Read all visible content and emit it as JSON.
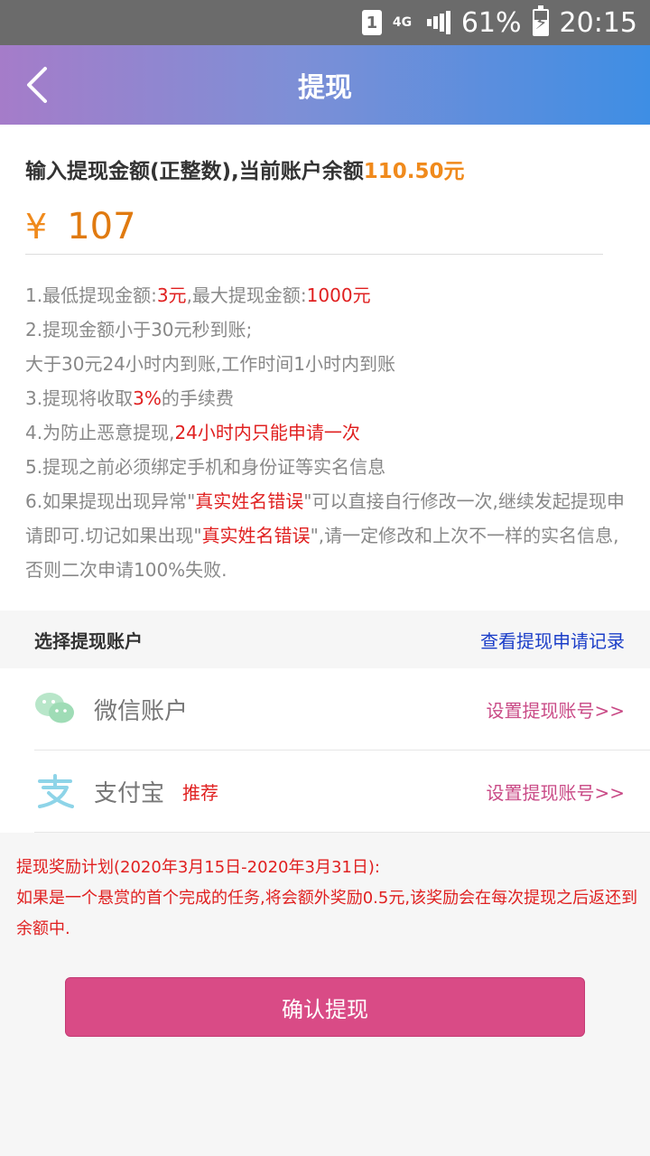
{
  "status_bar": {
    "sim": "1",
    "network": "4G",
    "battery": "61%",
    "time": "20:15"
  },
  "header": {
    "title": "提现",
    "background_gradient": [
      "#a57cc9",
      "#3e8ee4"
    ]
  },
  "amount": {
    "prompt_prefix": "输入提现金额(正整数),当前账户余额",
    "balance": "110.50元",
    "currency_symbol": "¥",
    "value": "107"
  },
  "rules": {
    "r1_a": "1.最低提现金额:",
    "r1_min": "3元",
    "r1_b": ",最大提现金额:",
    "r1_max": "1000元",
    "r2": "2.提现金额小于30元秒到账;",
    "r2b": "大于30元24小时内到账,工作时间1小时内到账",
    "r3_a": "3.提现将收取",
    "r3_fee": "3%",
    "r3_b": "的手续费",
    "r4_a": "4.为防止恶意提现,",
    "r4_limit": "24小时内只能申请一次",
    "r5": "5.提现之前必须绑定手机和身份证等实名信息",
    "r6_a": "6.如果提现出现异常\"",
    "r6_err1": "真实姓名错误",
    "r6_b": "\"可以直接自行修改一次,继续发起提现申请即可.切记如果出现\"",
    "r6_err2": "真实姓名错误",
    "r6_c": "\",请一定修改和上次不一样的实名信息,否则二次申请100%失败."
  },
  "accounts_section": {
    "title": "选择提现账户",
    "records_link": "查看提现申请记录",
    "items": [
      {
        "icon": "wechat-icon",
        "name": "微信账户",
        "badge": "",
        "action": "设置提现账号>>"
      },
      {
        "icon": "alipay-icon",
        "name": "支付宝",
        "badge": "推荐",
        "action": "设置提现账号>>"
      }
    ]
  },
  "reward": {
    "line1": "提现奖励计划(2020年3月15日-2020年3月31日):",
    "line2": "如果是一个悬赏的首个完成的任务,将会额外奖励0.5元,该奖励会在每次提现之后返还到余额中."
  },
  "confirm_button": {
    "label": "确认提现",
    "color": "#d94b86"
  },
  "colors": {
    "highlight_orange": "#f08a1c",
    "warning_red": "#e02020",
    "link_blue": "#1a3dc8",
    "action_pink": "#c94a86"
  }
}
